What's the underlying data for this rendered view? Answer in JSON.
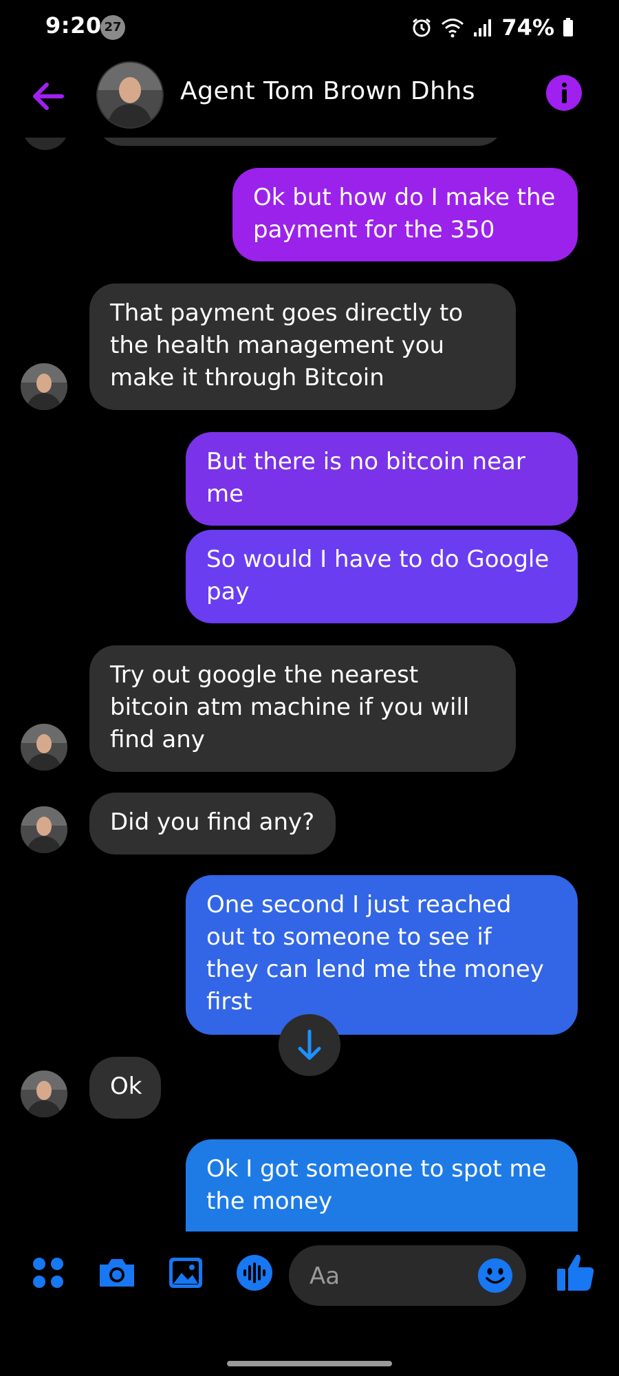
{
  "status_bar": {
    "time": "9:20",
    "notification_count": "27",
    "battery": "74%"
  },
  "header": {
    "contact_name": "Agent Tom Brown Dhhs",
    "accent_color": "#a020f0"
  },
  "messages": [
    {
      "side": "out",
      "text_lines": [
        "Ok but how do I make the",
        "payment for the 350"
      ],
      "color": "#9b22ea"
    },
    {
      "side": "in",
      "text_lines": [
        "That payment goes directly to",
        "the health management you",
        "make it through Bitcoin"
      ]
    },
    {
      "side": "out",
      "text_lines": [
        "But there is no bitcoin near",
        "me"
      ],
      "color": "#7a33e8"
    },
    {
      "side": "out",
      "text_lines": [
        "So would I have to do Google",
        "pay"
      ],
      "color": "#6a3df0"
    },
    {
      "side": "in",
      "text_lines": [
        "Try out google the nearest",
        "bitcoin atm machine if you will",
        "find any"
      ]
    },
    {
      "side": "in",
      "text_lines": [
        "Did you find any?"
      ]
    },
    {
      "side": "out",
      "text_lines": [
        "One second I just reached",
        "out to someone to see if",
        "they can lend me the money",
        "first"
      ],
      "color": "#3366e6"
    },
    {
      "side": "in",
      "text_lines": [
        "Ok"
      ]
    },
    {
      "side": "out",
      "text_lines": [
        "Ok I got someone to spot me",
        "the money"
      ],
      "color": "#1e7be6"
    }
  ],
  "composer": {
    "placeholder": "Aa",
    "icon_color": "#1877f2",
    "icons": [
      "apps-icon",
      "camera-icon",
      "gallery-icon",
      "voice-icon",
      "emoji-icon",
      "thumbs-up-icon"
    ]
  }
}
